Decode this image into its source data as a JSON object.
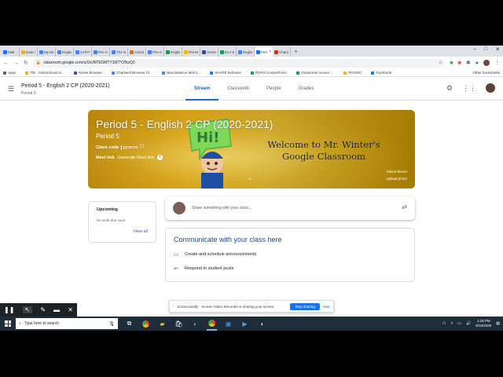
{
  "browser": {
    "tabs": [
      {
        "title": "Mail - V",
        "color": "#1a73e8"
      },
      {
        "title": "Data Ti",
        "color": "#f4b400"
      },
      {
        "title": "My Me",
        "color": "#4285f4"
      },
      {
        "title": "English",
        "color": "#4285f4"
      },
      {
        "title": "Cell Pr",
        "color": "#4285f4"
      },
      {
        "title": "Pre-AF",
        "color": "#4285f4"
      },
      {
        "title": "The N",
        "color": "#4285f4"
      },
      {
        "title": "Activity",
        "color": "#e8710a"
      },
      {
        "title": "Pre-AF",
        "color": "#4285f4"
      },
      {
        "title": "English",
        "color": "#0f9d58"
      },
      {
        "title": "RVHS",
        "color": "#f4b400"
      },
      {
        "title": "Aeries",
        "color": "#3949ab"
      },
      {
        "title": "ELA 9 I",
        "color": "#0f9d58"
      },
      {
        "title": "English",
        "color": "#4285f4"
      },
      {
        "title": "Peri",
        "color": "#1a73e8",
        "active": true
      },
      {
        "title": "Chann",
        "color": "#e62117"
      }
    ],
    "new_tab": "+",
    "window_controls": [
      "–",
      "□",
      "✕"
    ],
    "url": "classroom.google.com/u/0/c/MTE5MTY1MTY2NzQ0",
    "bookmarks": [
      {
        "label": "Apps",
        "color": "#5f6368"
      },
      {
        "label": "TIE - Instructional S...",
        "color": "#f4b400"
      },
      {
        "label": "Aeries Browser",
        "color": "#3949ab"
      },
      {
        "label": "Chartwell Browser Cl...",
        "color": "#4285f4"
      },
      {
        "label": "New Balance Men's...",
        "color": "#4285f4"
      },
      {
        "label": "SHAPE behavior",
        "color": "#1a73e8"
      },
      {
        "label": "RVHS-ContactForm",
        "color": "#0f9d58"
      },
      {
        "label": "Classroom moves -...",
        "color": "#0f9d58"
      },
      {
        "label": "RVHSIC",
        "color": "#f4b400"
      },
      {
        "label": "Facebook",
        "color": "#1877f2"
      }
    ],
    "other_bookmarks": "Other bookmarks"
  },
  "classroom": {
    "course_title": "Period 5 - English 2 CP (2020-2021)",
    "course_section": "Period 5",
    "tabs": [
      "Stream",
      "Classwork",
      "People",
      "Grades"
    ],
    "active_tab": "Stream"
  },
  "banner": {
    "title": "Period 5 - English 2 CP (2020-2021)",
    "section": "Period 5",
    "class_code_label": "Class code",
    "class_code": "jgxavnx",
    "meet_label": "Meet link",
    "meet_action": "Generate Meet link",
    "welcome_line1": "Welcome to Mr. Winter's",
    "welcome_line2": "Google Classroom",
    "hi_text": "Hi!",
    "select_theme": "Select theme",
    "upload_photo": "Upload photo",
    "accent": "#c9a227"
  },
  "upcoming": {
    "heading": "Upcoming",
    "empty_text": "No work due soon",
    "view_all": "View all"
  },
  "share": {
    "placeholder": "Share something with your class..."
  },
  "communicate": {
    "heading": "Communicate with your class here",
    "items": [
      {
        "icon": "announcement-icon",
        "label": "Create and schedule announcements"
      },
      {
        "icon": "reply-icon",
        "label": "Respond to student posts"
      }
    ]
  },
  "screencastify": {
    "notice": "Screencastify - Screen Video Recorder is sharing your screen.",
    "stop_label": "Stop sharing",
    "hide_label": "Hide"
  },
  "taskbar": {
    "search_placeholder": "Type here to search",
    "time": "1:18 PM",
    "date": "8/10/2020"
  }
}
